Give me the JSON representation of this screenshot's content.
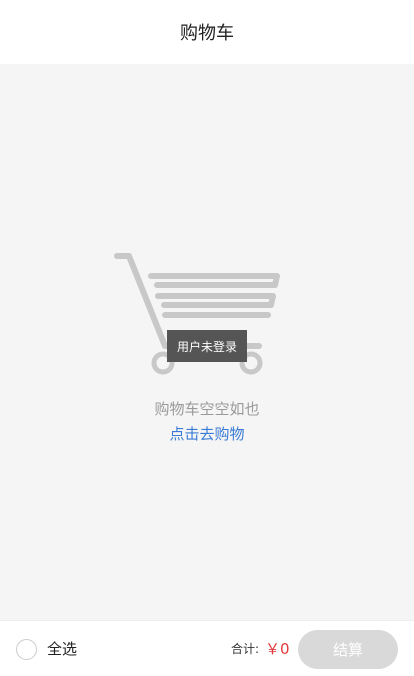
{
  "header": {
    "title": "购物车"
  },
  "empty_state": {
    "icon": "shopping-cart-icon",
    "badge": "用户未登录",
    "message": "购物车空空如也",
    "link": "点击去购物"
  },
  "footer": {
    "select_all_label": "全选",
    "total_label": "合计:",
    "total_value": "￥0",
    "checkout_label": "结算"
  },
  "colors": {
    "price": "#e4393c",
    "link": "#3a7bd5",
    "checkout_disabled": "#d9d9d9"
  }
}
